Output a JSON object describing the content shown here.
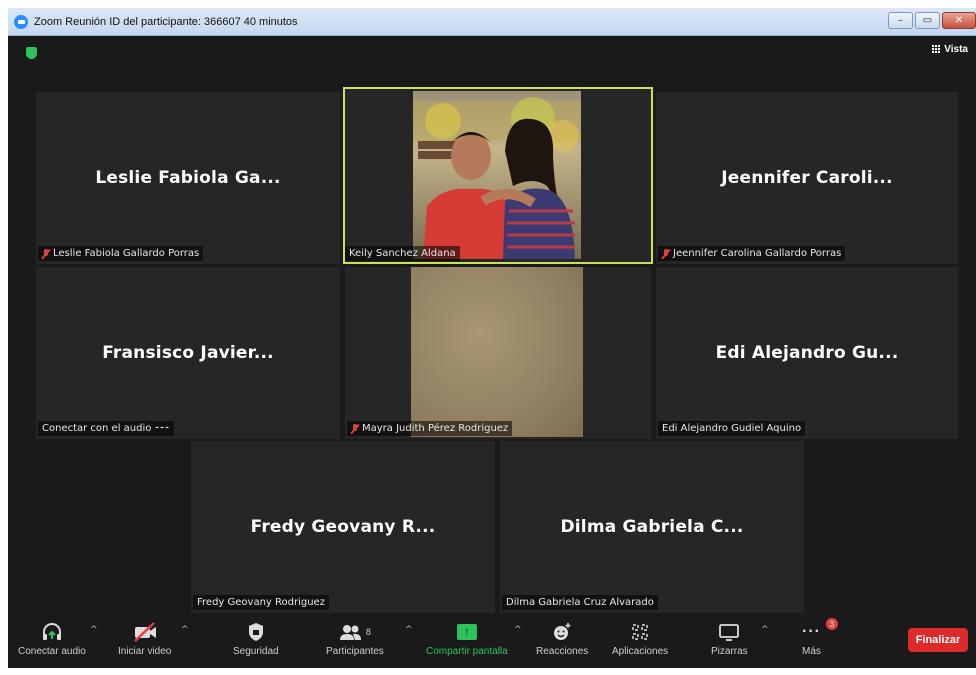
{
  "window": {
    "title": "Zoom Reunión ID del participante: 366607  40 minutos",
    "minimize": "–",
    "restore": "▭",
    "close": "✕"
  },
  "top_bar": {
    "view_label": "Vista"
  },
  "participants": [
    {
      "display_name": "Leslie Fabiola Ga...",
      "label": "Leslie Fabiola Gallardo Porras",
      "muted": true
    },
    {
      "display_name": "",
      "label": "Keily Sanchez Aldana",
      "muted": false,
      "video": "photo",
      "active_speaker": true
    },
    {
      "display_name": "Jeennifer  Caroli...",
      "label": "Jeennifer Carolina Gallardo Porras",
      "muted": true
    },
    {
      "display_name": "Fransisco  Javier...",
      "label": "Conectar con el audio ⁃⁃⁃",
      "muted": false
    },
    {
      "display_name": "",
      "label": "Mayra Judith Pérez Rodriguez",
      "muted": true,
      "video": "plain"
    },
    {
      "display_name": "Edi  Alejandro  Gu...",
      "label": "Edi Alejandro Gudiel Aquino",
      "muted": false
    },
    {
      "display_name": "Fredy  Geovany  R...",
      "label": "Fredy Geovany Rodriguez",
      "muted": false
    },
    {
      "display_name": "Dilma  Gabriela  C...",
      "label": "Dilma Gabriela Cruz Alvarado",
      "muted": false
    }
  ],
  "toolbar": {
    "audio": "Conectar audio",
    "video": "Iniciar video",
    "security": "Seguridad",
    "participants": "Participantes",
    "participants_count": "8",
    "share": "Compartir pantalla",
    "reactions": "Reacciones",
    "apps": "Aplicaciones",
    "whiteboards": "Pizarras",
    "more": "Más",
    "more_badge": "3",
    "end": "Finalizar"
  },
  "colors": {
    "active_speaker_border": "#c8e25d",
    "share_green": "#2ec25b",
    "end_red": "#dd2a2a",
    "muted_red": "#e0413b"
  }
}
